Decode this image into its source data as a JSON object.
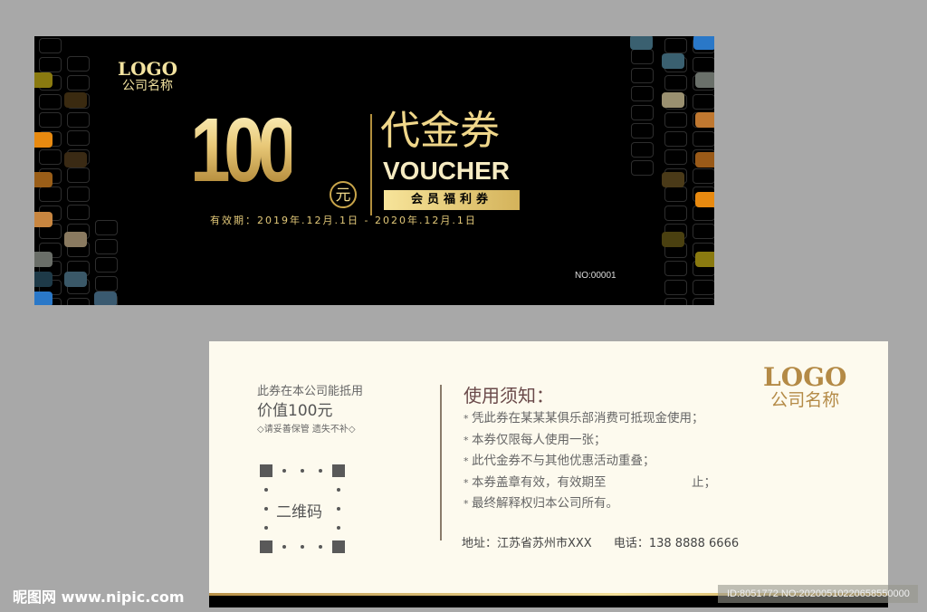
{
  "front": {
    "logo": "LOGO",
    "company": "公司名称",
    "amount": "100",
    "currency": "元",
    "title_cn": "代金券",
    "title_en": "VOUCHER",
    "badge": "会员福利券",
    "validity": "有效期：2019年.12月.1日 - 2020年.12月.1日",
    "serial": "NO:00001"
  },
  "back": {
    "use_text": "此券在本公司能抵用",
    "value_text": "价值100元",
    "keep_text": "◇请妥善保管 遗失不补◇",
    "qr_label": "二维码",
    "notice_title": "使用须知：",
    "rules": [
      "凭此券在某某某俱乐部消费可抵现金使用；",
      "本券仅限每人使用一张；",
      "此代金券不与其他优惠活动重叠；",
      "本券盖章有效，有效期至　　　　　　　止；",
      "最终解释权归本公司所有。"
    ],
    "address": "地址：江苏省苏州市XXX",
    "phone": "电话：138 8888 6666",
    "logo": "LOGO",
    "company": "公司名称"
  },
  "watermark": "昵图网 www.nipic.com",
  "image_id": "ID:8051772 NO:20200510220658550000",
  "colors": {
    "gold": "#e8c877",
    "background": "#a8a8a8",
    "card_back": "#fdfaee"
  }
}
